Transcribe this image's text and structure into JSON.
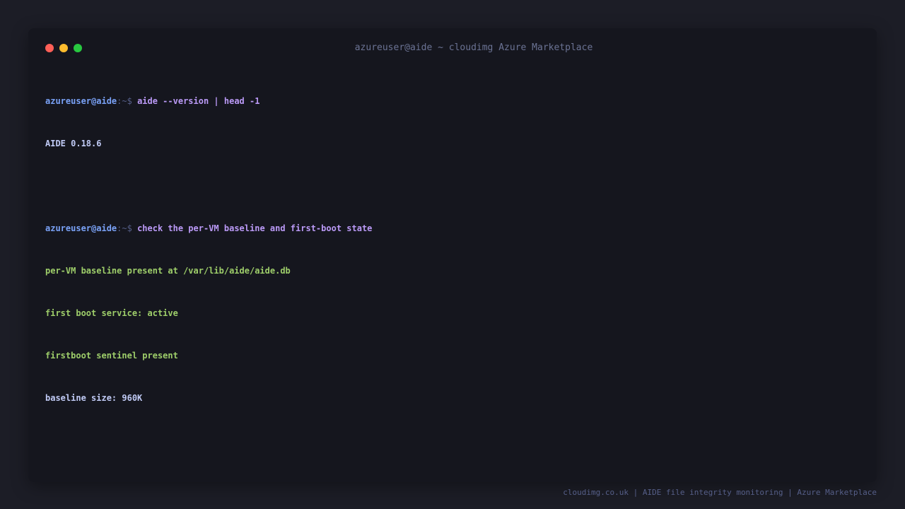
{
  "window": {
    "title": "azureuser@aide ~ cloudimg Azure Marketplace",
    "controls": {
      "close_color": "#ff5f57",
      "minimize_color": "#febc2e",
      "maximize_color": "#28c840"
    }
  },
  "terminal": {
    "lines": [
      {
        "kind": "prompt",
        "user": "azureuser@aide",
        "path": ":~$ ",
        "command": "aide --version | head -1"
      },
      {
        "kind": "output",
        "text": "AIDE 0.18.6"
      },
      {
        "kind": "blank"
      },
      {
        "kind": "prompt",
        "user": "azureuser@aide",
        "path": ":~$ ",
        "command": "check the per-VM baseline and first-boot state"
      },
      {
        "kind": "output-green",
        "text": "per-VM baseline present at /var/lib/aide/aide.db"
      },
      {
        "kind": "output-green",
        "text": "first boot service: active"
      },
      {
        "kind": "output-green",
        "text": "firstboot sentinel present"
      },
      {
        "kind": "output",
        "text": "baseline size: 960K"
      }
    ]
  },
  "footer": {
    "text": "cloudimg.co.uk | AIDE file integrity monitoring | Azure Marketplace"
  },
  "colors": {
    "background": "#1c1d26",
    "window": "#15161e",
    "prompt_user": "#7aa2f7",
    "command": "#bb9af7",
    "output_green": "#9ece6a",
    "output_plain": "#c0caf5"
  }
}
